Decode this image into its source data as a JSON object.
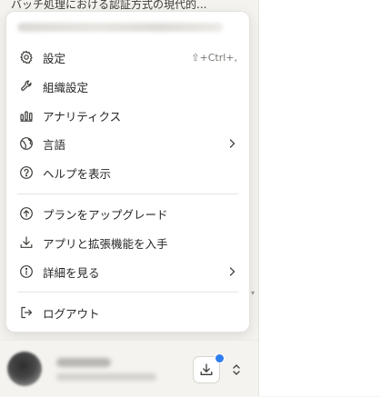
{
  "background": {
    "conversation_title": "バッチ処理における認証方式の現代的..."
  },
  "menu": {
    "items": [
      {
        "id": "settings",
        "label": "設定",
        "icon": "gear-icon",
        "shortcut": "⇧+Ctrl+,"
      },
      {
        "id": "org-settings",
        "label": "組織設定",
        "icon": "wrench-icon"
      },
      {
        "id": "analytics",
        "label": "アナリティクス",
        "icon": "bar-chart-icon"
      },
      {
        "id": "language",
        "label": "言語",
        "icon": "globe-icon",
        "has_submenu": true
      },
      {
        "id": "help",
        "label": "ヘルプを表示",
        "icon": "question-circle-icon"
      },
      {
        "id": "upgrade",
        "label": "プランをアップグレード",
        "icon": "arrow-up-circle-icon"
      },
      {
        "id": "apps",
        "label": "アプリと拡張機能を入手",
        "icon": "download-icon"
      },
      {
        "id": "details",
        "label": "詳細を見る",
        "icon": "info-circle-icon",
        "has_submenu": true
      },
      {
        "id": "logout",
        "label": "ログアウト",
        "icon": "logout-icon"
      }
    ]
  },
  "colors": {
    "notification_dot": "#2f7ef0",
    "text": "#262625",
    "muted": "#7a7873"
  }
}
